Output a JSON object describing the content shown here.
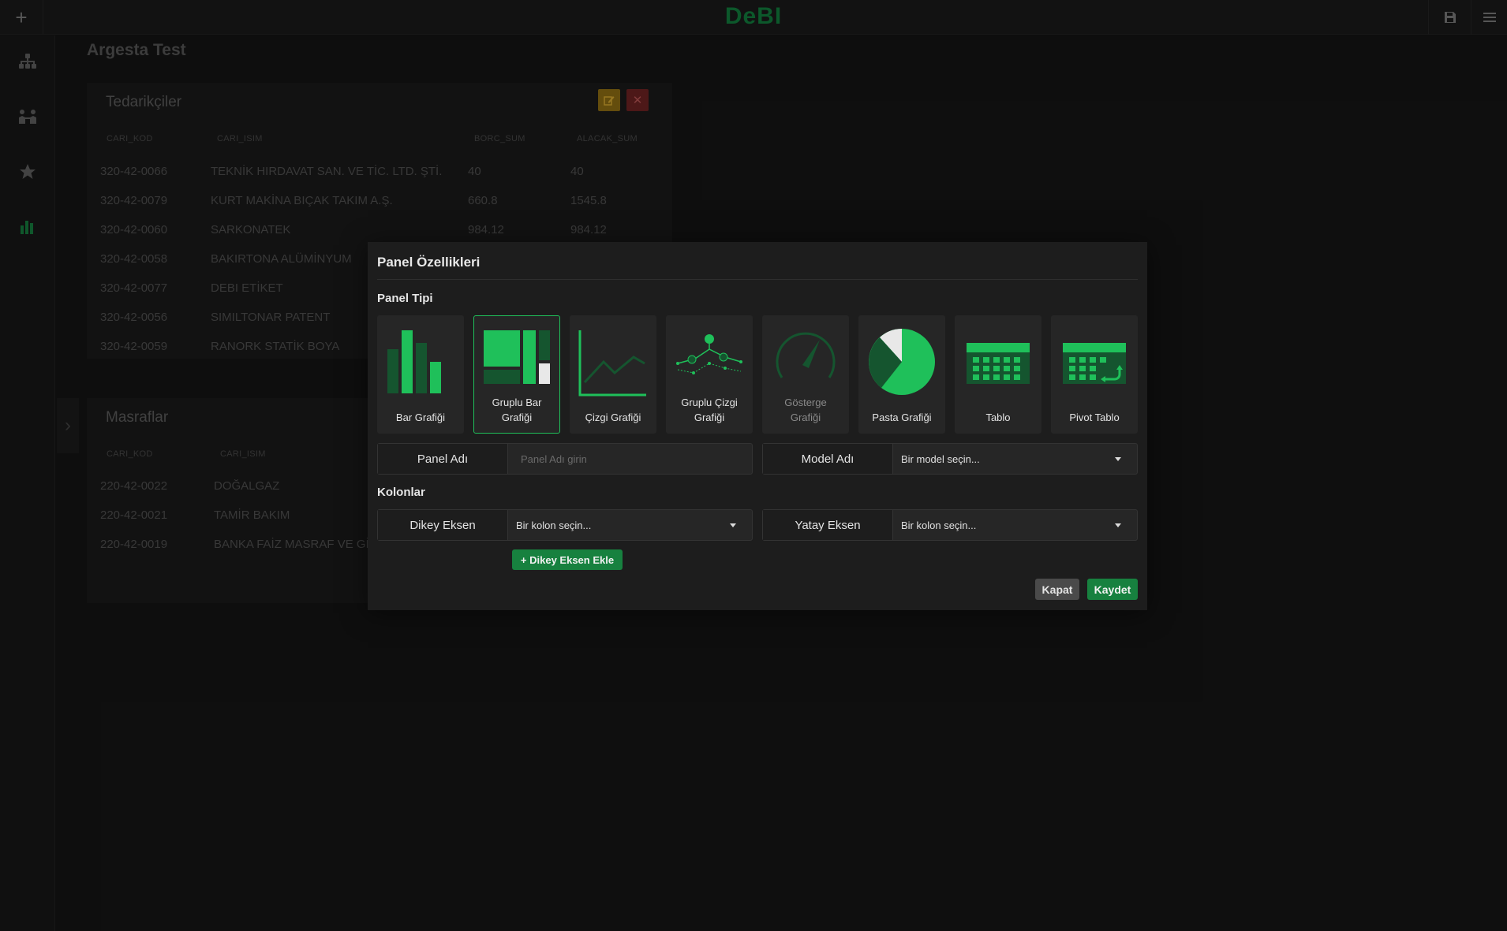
{
  "app": {
    "brand": "DeBI",
    "page_title": "Argesta Test"
  },
  "topbar": {
    "add_icon": "plus-icon",
    "save_icon": "floppy-disk-icon",
    "menu_icon": "hamburger-icon"
  },
  "sidebar": {
    "items": [
      {
        "icon": "sitemap-icon"
      },
      {
        "icon": "users-icon"
      },
      {
        "icon": "star-icon"
      },
      {
        "icon": "bar-chart-icon",
        "active": true
      }
    ]
  },
  "panels": [
    {
      "title": "Tedarikçiler",
      "columns": [
        "CARI_KOD",
        "CARI_ISIM",
        "BORC_SUM",
        "ALACAK_SUM"
      ],
      "rows": [
        [
          "320-42-0066",
          "TEKNİK HIRDAVAT SAN. VE TİC. LTD. ŞTİ.",
          "40",
          "40"
        ],
        [
          "320-42-0079",
          "KURT MAKİNA BIÇAK TAKIM A.Ş.",
          "660.8",
          "1545.8"
        ],
        [
          "320-42-0060",
          "SARKONATEK",
          "984.12",
          "984.12"
        ],
        [
          "320-42-0058",
          "BAKIRTONA ALÜMİNYUM",
          "",
          ""
        ],
        [
          "320-42-0077",
          "DEBI ETİKET",
          "",
          ""
        ],
        [
          "320-42-0056",
          "SIMILTONAR PATENT",
          "",
          ""
        ],
        [
          "320-42-0059",
          "RANORK STATİK BOYA",
          "",
          ""
        ]
      ]
    },
    {
      "title": "Masraflar",
      "columns": [
        "CARI_KOD",
        "CARI_ISIM"
      ],
      "rows": [
        [
          "220-42-0022",
          "DOĞALGAZ"
        ],
        [
          "220-42-0021",
          "TAMİR BAKIM"
        ],
        [
          "220-42-0019",
          "BANKA FAİZ MASRAF VE GİD"
        ]
      ]
    }
  ],
  "modal": {
    "title": "Panel Özellikleri",
    "panel_type_label": "Panel Tipi",
    "types": [
      {
        "label1": "Bar Grafiği",
        "label2": "",
        "icon": "bar-chart-icon"
      },
      {
        "label1": "Gruplu Bar",
        "label2": "Grafiği",
        "icon": "grouped-bar-chart-icon",
        "selected": true
      },
      {
        "label1": "Çizgi Grafiği",
        "label2": "",
        "icon": "line-chart-icon"
      },
      {
        "label1": "Gruplu Çizgi",
        "label2": "Grafiği",
        "icon": "grouped-line-chart-icon"
      },
      {
        "label1": "Gösterge",
        "label2": "Grafiği",
        "icon": "gauge-icon",
        "disabled": true
      },
      {
        "label1": "Pasta Grafiği",
        "label2": "",
        "icon": "pie-chart-icon"
      },
      {
        "label1": "Tablo",
        "label2": "",
        "icon": "table-icon"
      },
      {
        "label1": "Pivot Tablo",
        "label2": "",
        "icon": "pivot-table-icon"
      }
    ],
    "panel_name_label": "Panel Adı",
    "panel_name_placeholder": "Panel Adı girin",
    "model_name_label": "Model Adı",
    "model_name_value": "Bir model seçin...",
    "columns_label": "Kolonlar",
    "vertical_axis_label": "Dikey Eksen",
    "vertical_axis_value": "Bir kolon seçin...",
    "horizontal_axis_label": "Yatay Eksen",
    "horizontal_axis_value": "Bir kolon seçin...",
    "add_vertical_axis": "+ Dikey Eksen Ekle",
    "close_label": "Kapat",
    "save_label": "Kaydet"
  },
  "colors": {
    "accent": "#1fc05a",
    "accent_dark": "#17813f",
    "background": "#121212"
  }
}
